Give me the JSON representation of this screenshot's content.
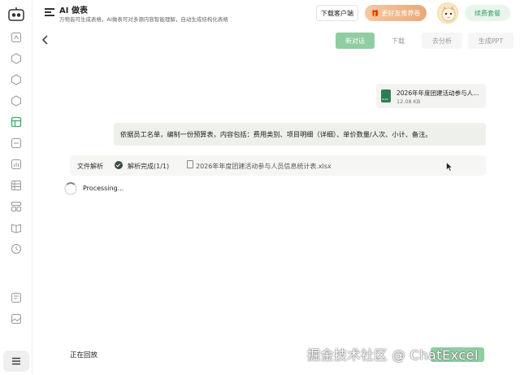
{
  "header": {
    "title": "AI 做表",
    "subtitle": "万物皆可生成表格，AI做表可对多源内容智能理解，自动生成结构化表格",
    "download_client": "下载客户端",
    "vip_label": "更好友推荐卷",
    "renew_label": "续费套餐"
  },
  "toolbar": {
    "tabs": [
      {
        "label": "新对话",
        "active": true
      },
      {
        "label": "下载",
        "active": false
      },
      {
        "label": "去分析",
        "active": false
      },
      {
        "label": "生成PPT",
        "active": false
      }
    ]
  },
  "chat": {
    "file": {
      "name": "2026年年度团建活动参与人员信息统计表.xlsx",
      "size": "12.08 KB",
      "ext": "XLSX"
    },
    "user_message": "依据员工名单，编制一份预算表，内容包括：费用类别、项目明细（详细）、单价数量/人次、小计、备注。",
    "parse": {
      "label": "文件解析",
      "status": "解析完成(1/1)",
      "file": "2026年年度团建活动参与人员信息统计表.xlsx"
    },
    "processing": "Processing..."
  },
  "footer": {
    "replaying": "正在回放",
    "watermark": "掘金技术社区 @ ChatExcel"
  },
  "colors": {
    "accent": "#8fcda2",
    "accent_dark": "#3daa6e",
    "vip_gradient_start": "#f3c9a2",
    "vip_gradient_end": "#e9a979"
  }
}
